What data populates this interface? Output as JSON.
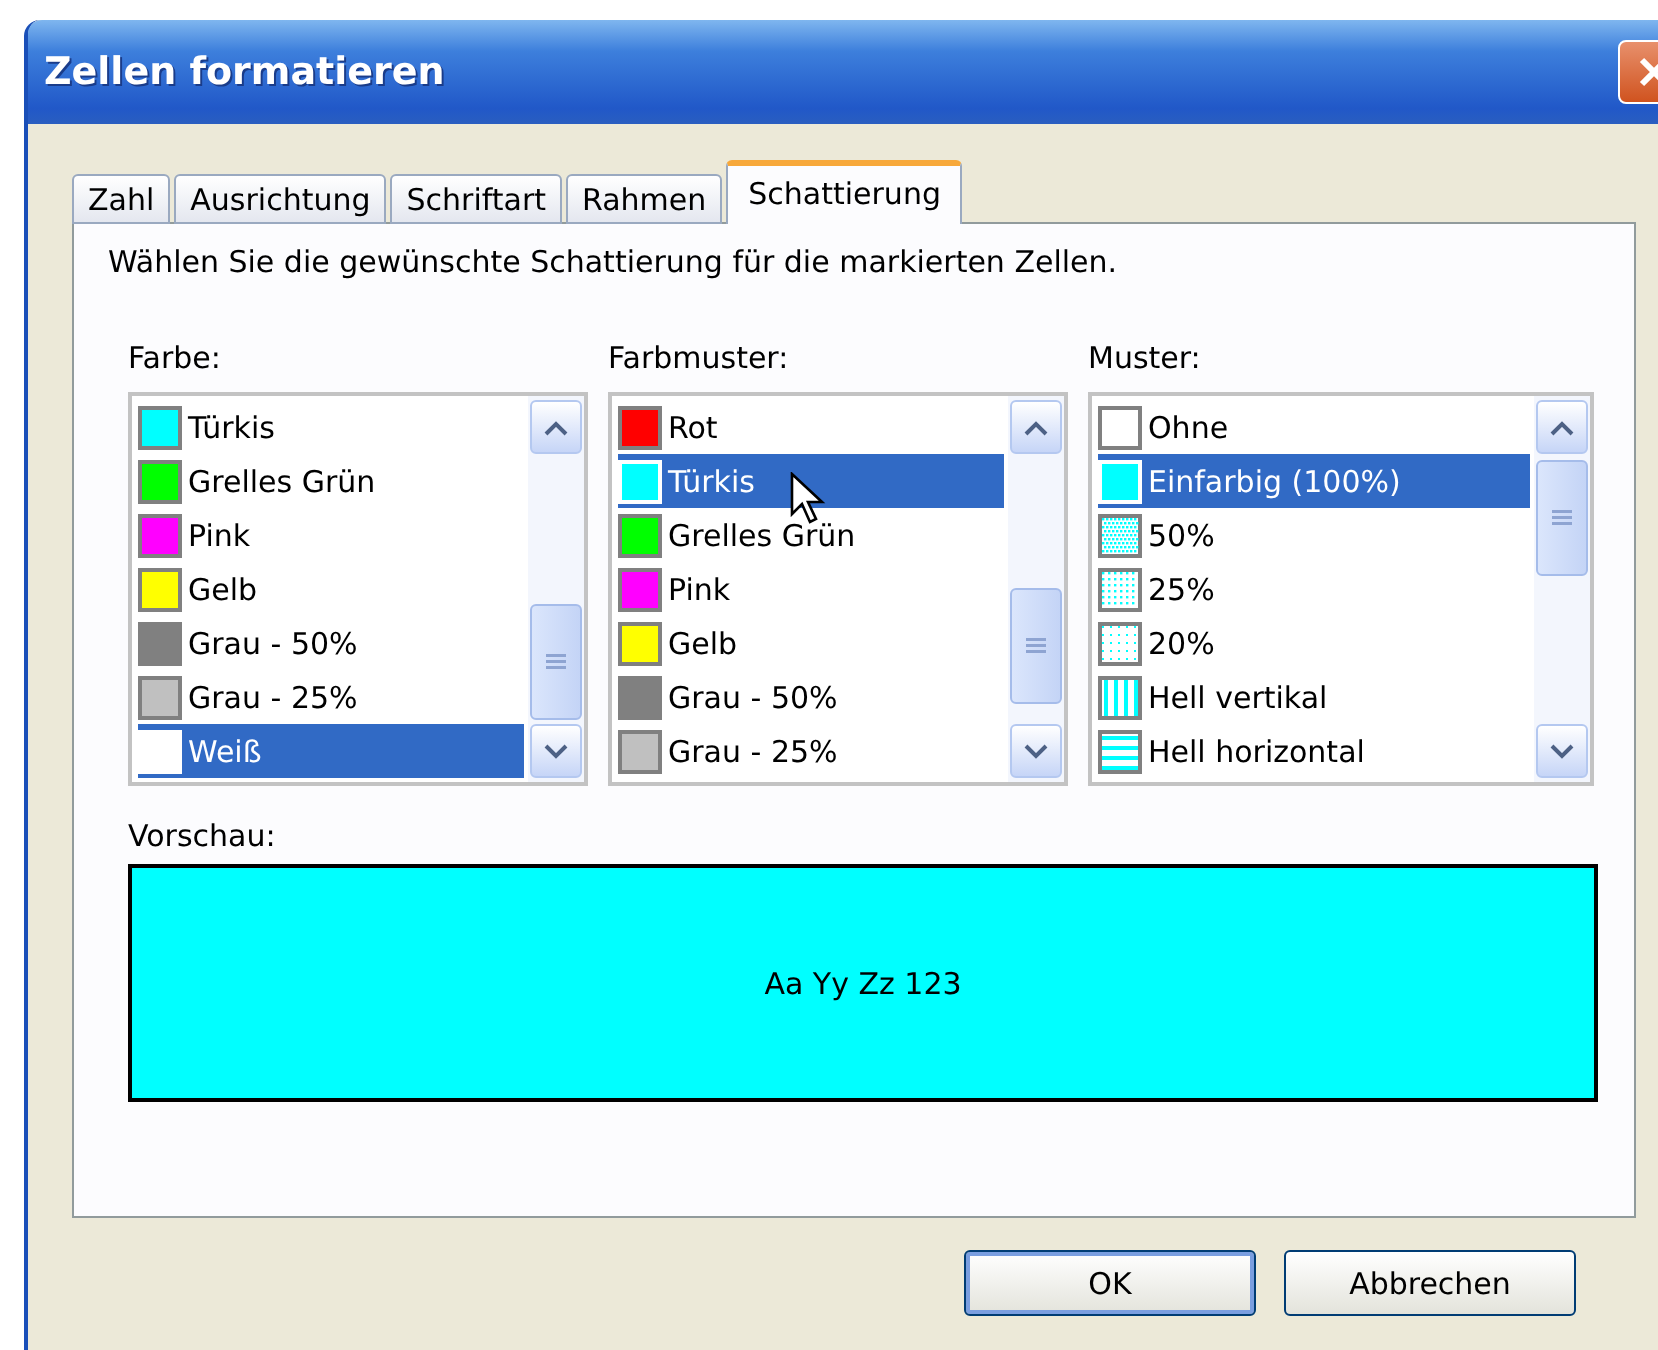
{
  "window": {
    "title": "Zellen formatieren"
  },
  "tabs": [
    {
      "label": "Zahl",
      "selected": false
    },
    {
      "label": "Ausrichtung",
      "selected": false
    },
    {
      "label": "Schriftart",
      "selected": false
    },
    {
      "label": "Rahmen",
      "selected": false
    },
    {
      "label": "Schattierung",
      "selected": true
    }
  ],
  "instruction": "Wählen Sie die gewünschte Schattierung für die markierten Zellen.",
  "lists": [
    {
      "label": "Farbe:",
      "items": [
        {
          "label": "Türkis",
          "color": "#00ffff",
          "selected": false
        },
        {
          "label": "Grelles Grün",
          "color": "#00ff00",
          "selected": false
        },
        {
          "label": "Pink",
          "color": "#ff00ff",
          "selected": false
        },
        {
          "label": "Gelb",
          "color": "#ffff00",
          "selected": false
        },
        {
          "label": "Grau - 50%",
          "color": "#808080",
          "selected": false
        },
        {
          "label": "Grau - 25%",
          "color": "#c0c0c0",
          "selected": false
        },
        {
          "label": "Weiß",
          "color": "#ffffff",
          "selected": true
        }
      ]
    },
    {
      "label": "Farbmuster:",
      "items": [
        {
          "label": "Rot",
          "color": "#ff0000",
          "selected": false
        },
        {
          "label": "Türkis",
          "color": "#00ffff",
          "selected": true
        },
        {
          "label": "Grelles Grün",
          "color": "#00ff00",
          "selected": false
        },
        {
          "label": "Pink",
          "color": "#ff00ff",
          "selected": false
        },
        {
          "label": "Gelb",
          "color": "#ffff00",
          "selected": false
        },
        {
          "label": "Grau - 50%",
          "color": "#808080",
          "selected": false
        },
        {
          "label": "Grau - 25%",
          "color": "#c0c0c0",
          "selected": false
        }
      ]
    },
    {
      "label": "Muster:",
      "items": [
        {
          "label": "Ohne",
          "kind": "none",
          "selected": false
        },
        {
          "label": "Einfarbig (100%)",
          "kind": "solid",
          "selected": true
        },
        {
          "label": "50%",
          "kind": "dots50",
          "selected": false
        },
        {
          "label": "25%",
          "kind": "dots25",
          "selected": false
        },
        {
          "label": "20%",
          "kind": "dots20",
          "selected": false
        },
        {
          "label": "Hell vertikal",
          "kind": "vertical",
          "selected": false
        },
        {
          "label": "Hell horizontal",
          "kind": "horizontal",
          "selected": false
        }
      ]
    }
  ],
  "preview": {
    "label": "Vorschau:",
    "text": "Aa Yy Zz 123"
  },
  "buttons": [
    "OK",
    "Abbrechen"
  ]
}
